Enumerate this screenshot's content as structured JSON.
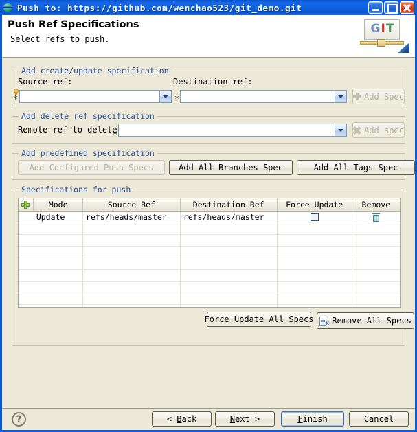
{
  "window": {
    "title": "Push to: https://github.com/wenchao523/git_demo.git",
    "icon": "git-push-icon",
    "minimize_label": "Minimize",
    "maximize_label": "Maximize",
    "close_label": "Close"
  },
  "header": {
    "title": "Push Ref Specifications",
    "subtitle": "Select refs to push.",
    "logo_g": "G",
    "logo_i": "I",
    "logo_t": "T"
  },
  "create_update": {
    "legend": "Add create/update specification",
    "source_label": "Source ref:",
    "destination_label": "Destination ref:",
    "source_value": "",
    "destination_value": "",
    "source_marker": "*",
    "destination_marker": "*",
    "add_spec_label": "Add Spec"
  },
  "delete_spec": {
    "legend": "Add delete ref specification",
    "remote_label": "Remote ref to delete:",
    "remote_value": "",
    "remote_marker": "*",
    "add_spec_label": "Add spec"
  },
  "predefined": {
    "legend": "Add predefined specification",
    "configured_label": "Add Configured Push Specs",
    "all_branches_label": "Add All Branches Spec",
    "all_tags_label": "Add All Tags Spec"
  },
  "specifications": {
    "legend": "Specifications for push",
    "columns": [
      "",
      "Mode",
      "Source Ref",
      "Destination Ref",
      "Force Update",
      "Remove"
    ],
    "rows": [
      {
        "mode": "Update",
        "source_ref": "refs/heads/master",
        "destination_ref": "refs/heads/master",
        "force_update": false,
        "remove_icon": "trash-icon"
      }
    ],
    "empty_row_count": 8,
    "force_update_all_label": "Force Update All Specs",
    "remove_all_label": "Remove All Specs"
  },
  "footer": {
    "help_label": "?",
    "back_label": "< Back",
    "back_mnemonic": "B",
    "next_label": "Next >",
    "next_mnemonic": "N",
    "finish_label": "Finish",
    "finish_mnemonic": "F",
    "cancel_label": "Cancel"
  },
  "colors": {
    "titlebar_blue": "#1164E2",
    "dialog_background": "#ECE9D8",
    "legend_text": "#2B4D9B",
    "field_white": "#FFFFFF",
    "plus_green": "#78B23C",
    "trash_teal": "#5FA8AE"
  }
}
